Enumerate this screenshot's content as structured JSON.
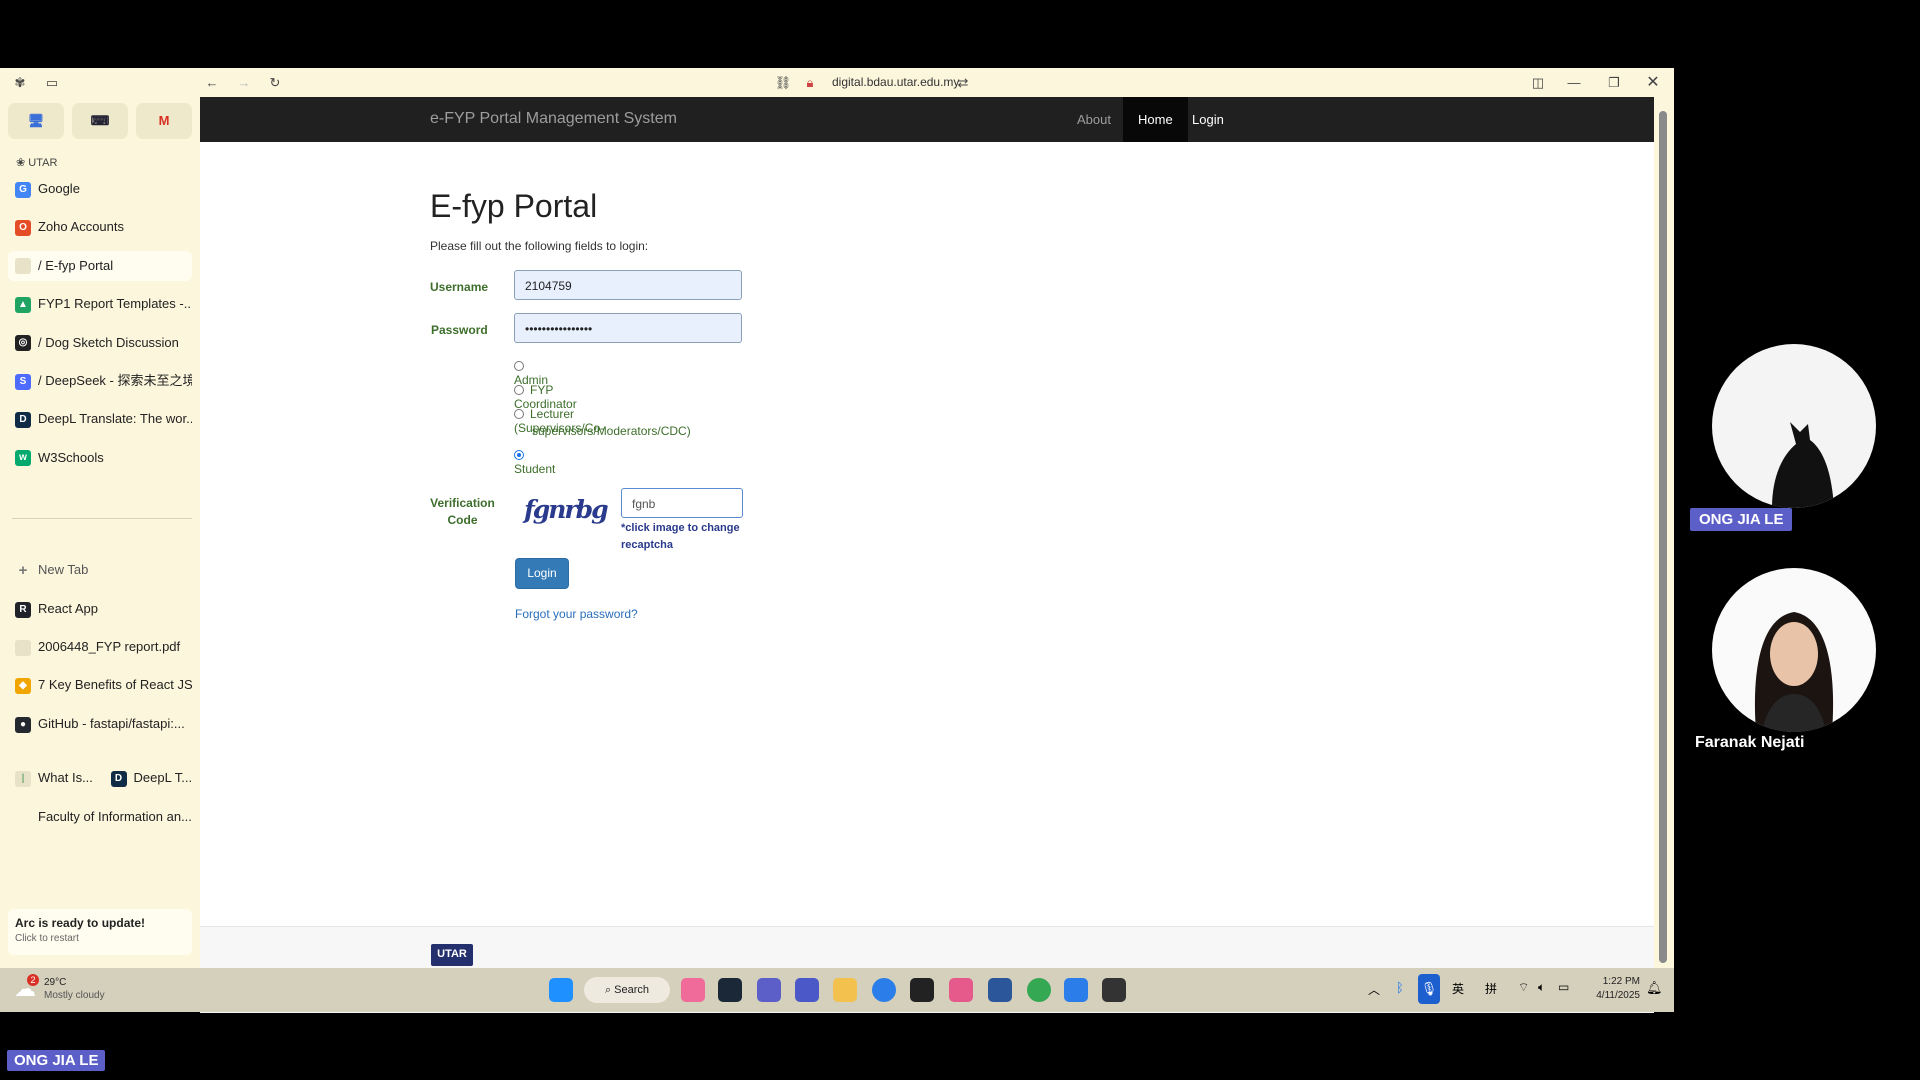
{
  "browser": {
    "url": "digital.bdau.utar.edu.my",
    "pinned": [
      {
        "icon": "monitor-icon",
        "label": ""
      },
      {
        "icon": "keyboard-icon",
        "label": ""
      },
      {
        "icon": "gmail-icon",
        "label": "M"
      }
    ],
    "space_label": "UTAR",
    "tabs_top": [
      {
        "label": "Google",
        "icon": "G",
        "color": "#4285f4"
      },
      {
        "label": "Zoho Accounts",
        "icon": "O",
        "color": "#e44d26"
      },
      {
        "label": "/  E-fyp Portal",
        "icon": "",
        "color": "#e8e2c8"
      },
      {
        "label": "FYP1 Report Templates -...",
        "icon": "▲",
        "color": "#1fa463"
      },
      {
        "label": "/  Dog Sketch Discussion",
        "icon": "◎",
        "color": "#222222"
      },
      {
        "label": "/  DeepSeek - 探索未至之境",
        "icon": "S",
        "color": "#4d6bfe"
      },
      {
        "label": "DeepL Translate: The wor...",
        "icon": "D",
        "color": "#0f2b46"
      },
      {
        "label": "W3Schools",
        "icon": "w",
        "color": "#04aa6d"
      }
    ],
    "new_tab": "New Tab",
    "tabs_bottom": [
      {
        "label": "React App",
        "icon": "R",
        "color": "#20232a"
      },
      {
        "label": "2006448_FYP report.pdf",
        "icon": "",
        "color": "#e8e2c8"
      },
      {
        "label": "7 Key Benefits of React JS...",
        "icon": "◆",
        "color": "#f0a500"
      },
      {
        "label": "GitHub - fastapi/fastapi:...",
        "icon": "●",
        "color": "#24292f"
      },
      {
        "label": "Faculty of Information an...",
        "icon": "",
        "color": "#fbf6dc"
      }
    ],
    "split_tab": {
      "left": "What Is...",
      "right": "DeepL T..."
    },
    "update_title": "Arc is ready to update!",
    "update_sub": "Click to restart"
  },
  "site": {
    "brand": "e-FYP Portal Management System",
    "nav": [
      "About",
      "Home",
      "Login"
    ],
    "title": "E-fyp Portal",
    "subtitle": "Please fill out the following fields to login:",
    "username_label": "Username",
    "username_value": "2104759",
    "password_label": "Password",
    "password_value": "••••••••••••••••",
    "roles": [
      "Admin",
      "FYP Coordinator",
      "Lecturer (Supervisors/Co-",
      "supervisors/Moderators/CDC)",
      "Student"
    ],
    "selected_role": "Student",
    "verification_label_1": "Verification",
    "verification_label_2": "Code",
    "captcha_image_text": "fgnrbg",
    "captcha_value": "fgnb",
    "captcha_hint_1": "*click image to change",
    "captcha_hint_2": "recaptcha",
    "login_button": "Login",
    "forgot": "Forgot your password?",
    "footer_logo": "UTAR"
  },
  "taskbar": {
    "weather_temp": "29°C",
    "weather_desc": "Mostly cloudy",
    "weather_badge": "2",
    "search": "Search",
    "ime_1": "英",
    "ime_2": "拼",
    "time": "1:22 PM",
    "date": "4/11/2025"
  },
  "meeting": {
    "participant_1": "ONG JIA LE",
    "participant_2": "Faranak Nejati",
    "self_label": "ONG JIA LE"
  },
  "colors": {
    "sidebar_bg": "#fbf6dc",
    "navbar_bg": "#202020",
    "login_btn": "#337ab7",
    "link": "#2a6ebb",
    "label_green": "#3d6e2c",
    "name_tag": "#5b5fc7"
  }
}
